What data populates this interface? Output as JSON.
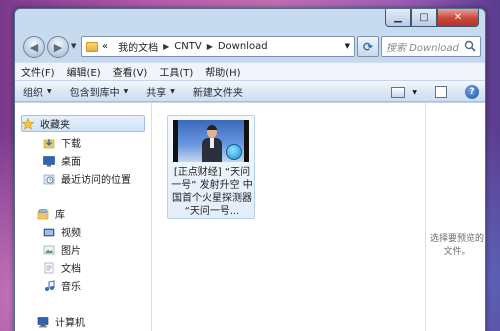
{
  "window": {
    "caption_buttons": {
      "minimize": "▁",
      "maximize": "□",
      "close": "✕"
    }
  },
  "address": {
    "overflow": "«",
    "crumbs": [
      "我的文档",
      "CNTV",
      "Download"
    ]
  },
  "search": {
    "placeholder": "搜索 Download"
  },
  "menu": [
    "文件(F)",
    "编辑(E)",
    "查看(V)",
    "工具(T)",
    "帮助(H)"
  ],
  "toolbar": {
    "organize": "组织",
    "include_in_library": "包含到库中",
    "share": "共享",
    "new_folder": "新建文件夹",
    "help_label": "?"
  },
  "sidebar": {
    "favorites": {
      "label": "收藏夹",
      "items": [
        "下载",
        "桌面",
        "最近访问的位置"
      ]
    },
    "libraries": {
      "label": "库",
      "items": [
        "视频",
        "图片",
        "文档",
        "音乐"
      ]
    },
    "computer": {
      "label": "计算机"
    }
  },
  "files": [
    {
      "name": "[正点财经] “天问一号” 发射升空 中国首个火星探测器 “天问一号..."
    }
  ],
  "preview": {
    "empty_text": "选择要预览的文件。"
  },
  "colors": {
    "accent": "#2d6db7",
    "selection": "#cfe3f8"
  }
}
